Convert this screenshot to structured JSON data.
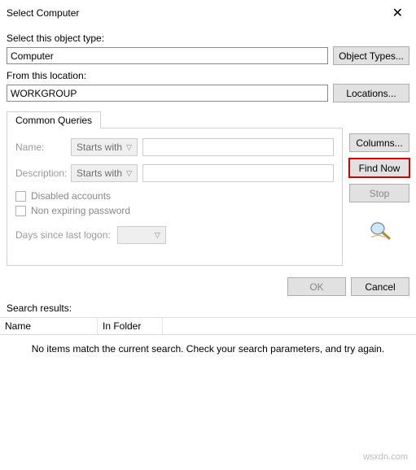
{
  "title": "Select Computer",
  "objectType": {
    "label": "Select this object type:",
    "value": "Computer",
    "button": "Object Types..."
  },
  "location": {
    "label": "From this location:",
    "value": "WORKGROUP",
    "button": "Locations..."
  },
  "tab": "Common Queries",
  "queries": {
    "nameLabel": "Name:",
    "nameMode": "Starts with",
    "descLabel": "Description:",
    "descMode": "Starts with",
    "disabledAccounts": "Disabled accounts",
    "nonExpiring": "Non expiring password",
    "daysLabel": "Days since last logon:"
  },
  "rightButtons": {
    "columns": "Columns...",
    "findNow": "Find Now",
    "stop": "Stop"
  },
  "bottom": {
    "ok": "OK",
    "cancel": "Cancel"
  },
  "results": {
    "label": "Search results:",
    "colName": "Name",
    "colFolder": "In Folder",
    "empty": "No items match the current search. Check your search parameters, and try again."
  },
  "watermark": "wsxdn.com"
}
